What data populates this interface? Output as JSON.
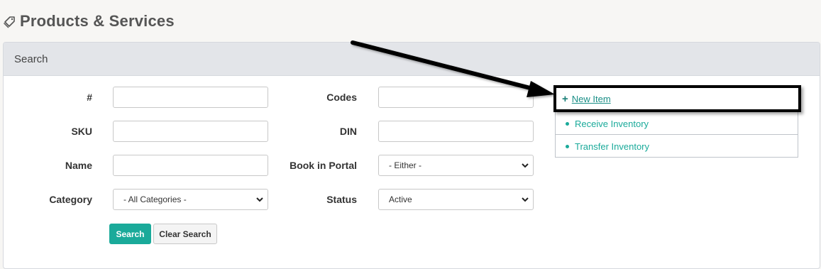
{
  "page": {
    "title": "Products & Services",
    "title_icon": "tag-icon"
  },
  "search_panel": {
    "header": "Search"
  },
  "form": {
    "number_label": "#",
    "sku_label": "SKU",
    "name_label": "Name",
    "category_label": "Category",
    "category_value": "- All Categories -",
    "codes_label": "Codes",
    "din_label": "DIN",
    "book_in_portal_label": "Book in Portal",
    "book_in_portal_value": "- Either -",
    "status_label": "Status",
    "status_value": "Active"
  },
  "buttons": {
    "search": "Search",
    "clear_search": "Clear Search"
  },
  "actions": {
    "new_item": "New Item",
    "receive_inventory": "Receive Inventory",
    "transfer_inventory": "Transfer Inventory"
  },
  "colors": {
    "accent": "#1aaa9a",
    "header_bg": "#e3e5e9",
    "page_bg": "#f7f6f4"
  }
}
